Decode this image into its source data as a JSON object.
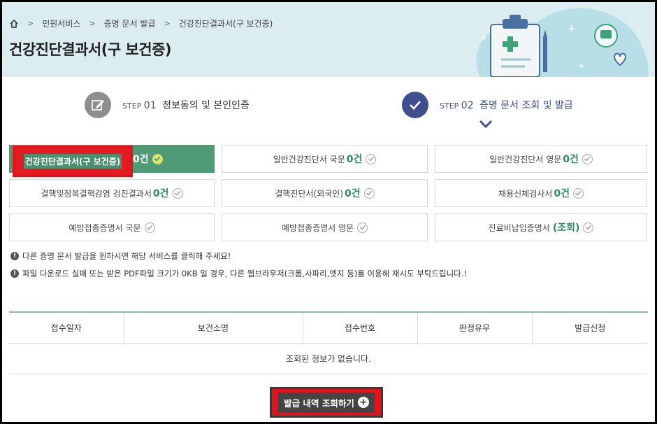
{
  "breadcrumb": {
    "items": [
      "민원서비스",
      "증명 문서 발급",
      "건강진단결과서(구 보건증)"
    ]
  },
  "page_title": "건강진단결과서(구 보건증)",
  "steps": [
    {
      "num_prefix": "STEP",
      "num": "01",
      "label": "정보동의 및 본인인증"
    },
    {
      "num_prefix": "STEP",
      "num": "02",
      "label": "증명 문서 조회 및 발급"
    }
  ],
  "documents": [
    {
      "label": "건강진단결과서(구 보건증)",
      "count": "0건",
      "active": true
    },
    {
      "label": "일반건강진단서 국문",
      "count": "0건"
    },
    {
      "label": "일반건강진단서 영문",
      "count": "0건"
    },
    {
      "label": "결핵및잠복결핵감염 검진결과서",
      "count": "0건"
    },
    {
      "label": "결핵진단서(외국인)",
      "count": "0건"
    },
    {
      "label": "채용신체검사서",
      "count": "0건"
    },
    {
      "label": "예방접종증명서 국문",
      "count": ""
    },
    {
      "label": "예방접종증명서 영문",
      "count": ""
    },
    {
      "label": "진료비납입증명서",
      "count": "(조회)"
    }
  ],
  "notes": [
    "다른 증명 문서 발급을 원하시면 해당 서비스를 클릭해 주세요!",
    "파일 다운로드 실패 또는 받은 PDF파일 크기가 0KB 일 경우, 다른 웹브라우저(크롬,사파리,엣지 등)를 이용해 재시도 부탁드립니다.!"
  ],
  "table": {
    "headers": [
      "접수일자",
      "보건소명",
      "접수번호",
      "판정유무",
      "발급신청"
    ],
    "empty_message": "조회된 정보가 없습니다."
  },
  "search_button": {
    "label": "발급 내역 조회하기"
  },
  "colors": {
    "header_bg": "#dcedf2",
    "active_green": "#4f9b77",
    "step_active": "#3f4e8c",
    "highlight_red": "#e1141b"
  }
}
